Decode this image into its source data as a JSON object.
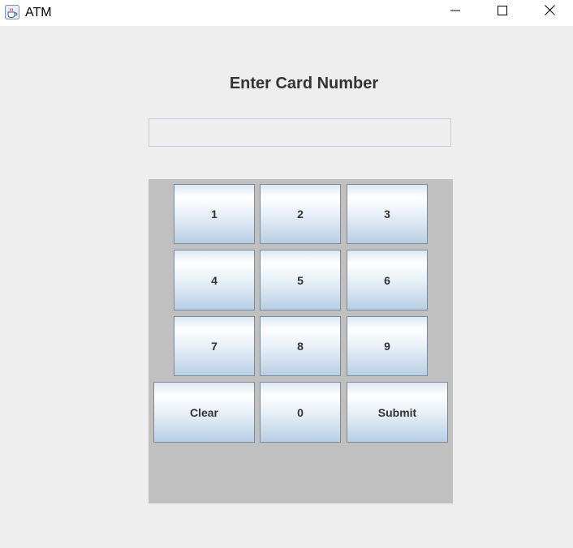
{
  "window": {
    "title": "ATM",
    "icon": "java-cup-icon",
    "controls": {
      "minimize": "minimize-icon",
      "maximize": "maximize-icon",
      "close": "close-icon"
    }
  },
  "form": {
    "heading": "Enter Card Number",
    "card_number_value": "",
    "card_number_placeholder": ""
  },
  "keypad": {
    "keys": {
      "k1": "1",
      "k2": "2",
      "k3": "3",
      "k4": "4",
      "k5": "5",
      "k6": "6",
      "k7": "7",
      "k8": "8",
      "k9": "9",
      "clear": "Clear",
      "k0": "0",
      "submit": "Submit"
    }
  },
  "colors": {
    "background": "#eeeeee",
    "keypad_background": "#c0c0c0",
    "button_gradient_bottom": "#b8cfe5",
    "input_border": "#b8cfe5",
    "heading_text": "#333333"
  }
}
